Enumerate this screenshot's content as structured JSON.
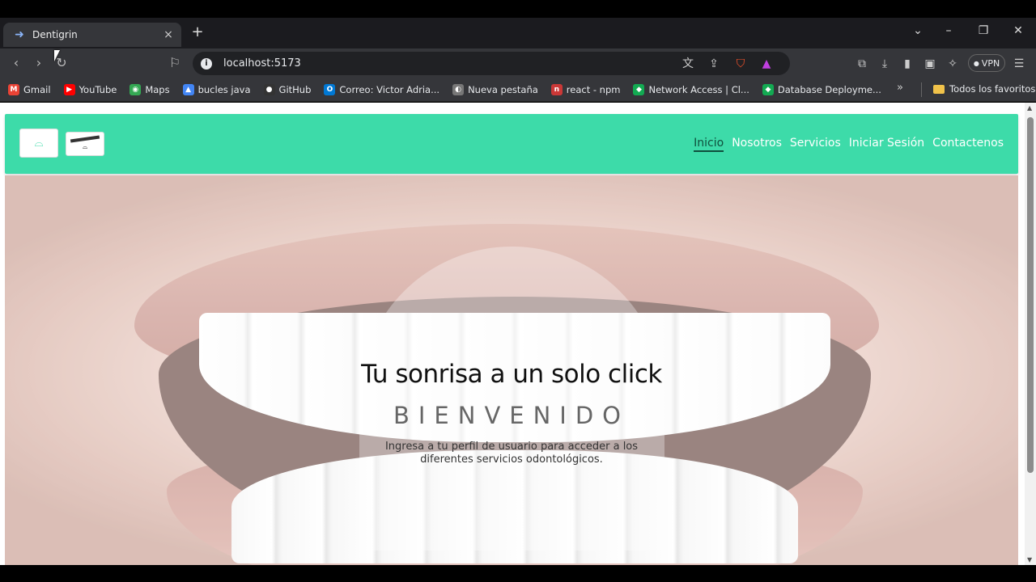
{
  "browser": {
    "tab_title": "Dentigrin",
    "tab_close": "×",
    "new_tab": "+",
    "address": "localhost:5173",
    "vpn_label": "VPN",
    "bookmarks": [
      {
        "label": "Gmail",
        "color": "#ea4335",
        "icon": "M"
      },
      {
        "label": "YouTube",
        "color": "#ff0000",
        "icon": "▶"
      },
      {
        "label": "Maps",
        "color": "#34a853",
        "icon": "◉"
      },
      {
        "label": "bucles java",
        "color": "#4285f4",
        "icon": "▲"
      },
      {
        "label": "GitHub",
        "color": "#333333",
        "icon": "●"
      },
      {
        "label": "Correo: Victor Adria...",
        "color": "#0078d4",
        "icon": "O"
      },
      {
        "label": "Nueva pestaña",
        "color": "#777777",
        "icon": "◐"
      },
      {
        "label": "react - npm",
        "color": "#cb3837",
        "icon": "n"
      },
      {
        "label": "Network Access | Cl...",
        "color": "#13aa52",
        "icon": "◆"
      },
      {
        "label": "Database Deployme...",
        "color": "#13aa52",
        "icon": "◆"
      }
    ],
    "bookmarks_more": "»",
    "all_favorites": "Todos los favoritos"
  },
  "site": {
    "nav": {
      "links": [
        "Inicio",
        "Nosotros",
        "Servicios",
        "Iniciar Sesión",
        "Contactenos"
      ],
      "active": "Inicio"
    },
    "hero": {
      "title": "Tu sonrisa a un solo click",
      "subtitle": "BIENVENIDO",
      "description": "Ingresa a tu perfil de usuario para acceder a los diferentes servicios odontológicos."
    },
    "accent_color": "#3ddba9"
  }
}
